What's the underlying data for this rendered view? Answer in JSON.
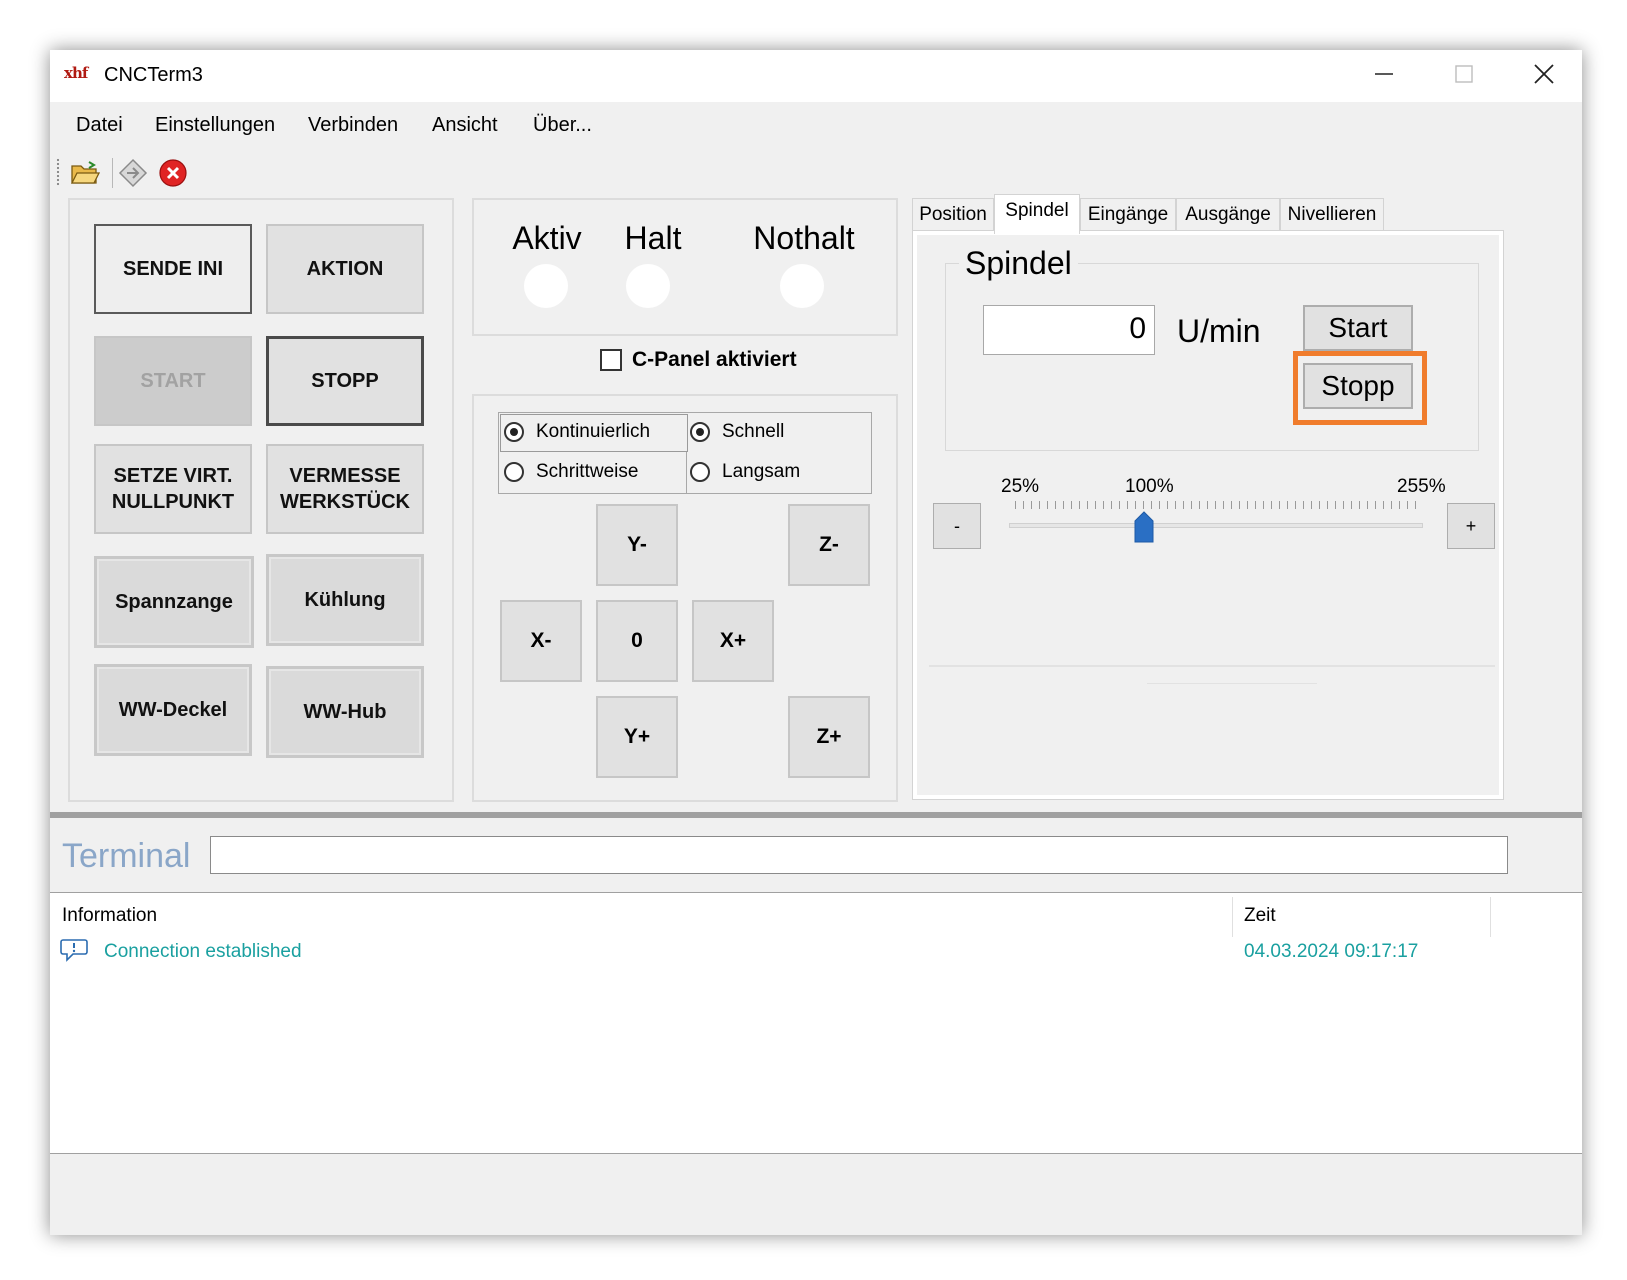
{
  "window": {
    "logo_text": "xhf",
    "title": "CNCTerm3",
    "minimize_glyph": "—",
    "maximize_glyph": "☐",
    "close_glyph": "✕"
  },
  "menu": [
    "Datei",
    "Einstellungen",
    "Verbinden",
    "Ansicht",
    "Über..."
  ],
  "toolbar": {
    "icons": [
      "open-folder-icon",
      "connect-icon",
      "disconnect-icon"
    ]
  },
  "actions": {
    "sende_ini": "SENDE INI",
    "aktion": "AKTION",
    "start": "START",
    "stopp": "STOPP",
    "setze_nullpunkt": "SETZE VIRT.\nNULLPUNKT",
    "vermesse_werkstueck": "VERMESSE\nWERKSTÜCK",
    "spannzange": "Spannzange",
    "kuehlung": "Kühlung",
    "ww_deckel": "WW-Deckel",
    "ww_hub": "WW-Hub"
  },
  "status": {
    "aktiv": "Aktiv",
    "halt": "Halt",
    "nothalt": "Nothalt",
    "led_color": "#ffffff"
  },
  "cpanel": {
    "label": "C-Panel aktiviert",
    "checked": false
  },
  "jog_mode": {
    "kontinuierlich": "Kontinuierlich",
    "schrittweise": "Schrittweise",
    "selected": "Kontinuierlich"
  },
  "jog_speed": {
    "schnell": "Schnell",
    "langsam": "Langsam",
    "selected": "Schnell"
  },
  "jog": {
    "y_minus": "Y-",
    "z_minus": "Z-",
    "x_minus": "X-",
    "zero": "0",
    "x_plus": "X+",
    "y_plus": "Y+",
    "z_plus": "Z+"
  },
  "tabs": [
    "Position",
    "Spindel",
    "Eingänge",
    "Ausgänge",
    "Nivellieren"
  ],
  "active_tab": "Spindel",
  "spindel": {
    "group_title": "Spindel",
    "rpm_value": "0",
    "unit": "U/min",
    "start_label": "Start",
    "stopp_label": "Stopp",
    "highlight_color": "#f07c2c",
    "override": {
      "minus_label": "-",
      "plus_label": "+",
      "tick_min": "25%",
      "tick_mid": "100%",
      "tick_max": "255%",
      "min": 25,
      "max": 255,
      "value": 100,
      "thumb_color": "#2a6fc4"
    }
  },
  "terminal": {
    "label": "Terminal",
    "input_value": ""
  },
  "log": {
    "columns": [
      "Information",
      "Zeit"
    ],
    "rows": [
      {
        "icon": "info-bubble-icon",
        "message": "Connection established",
        "time": "04.03.2024 09:17:17"
      }
    ]
  }
}
